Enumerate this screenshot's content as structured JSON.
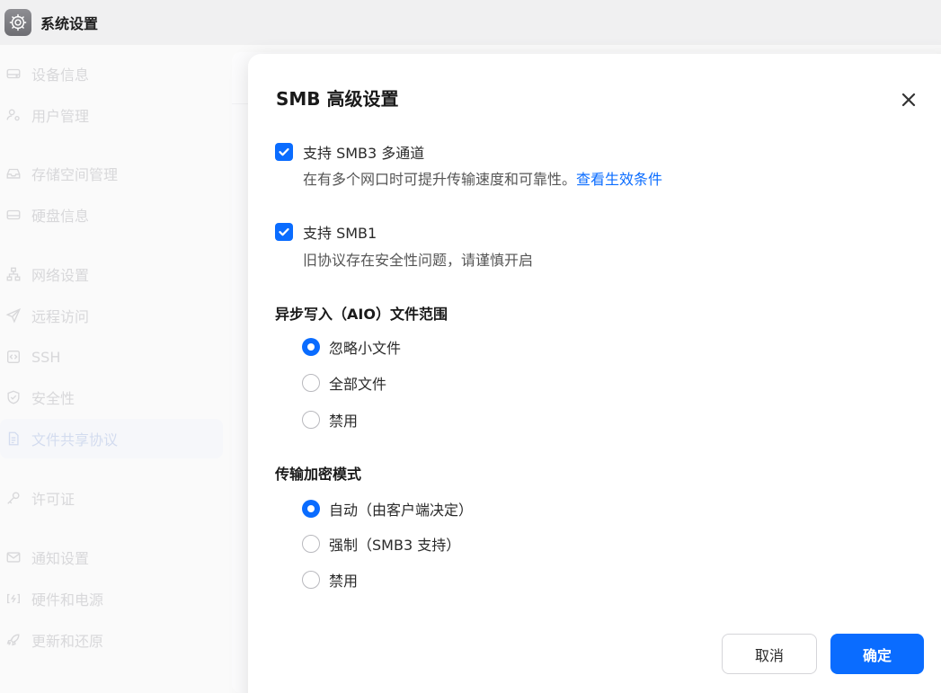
{
  "titlebar": {
    "app_icon": "gear-icon",
    "title": "系统设置"
  },
  "sidebar": {
    "items": [
      {
        "label": "设备信息",
        "icon": "drive-icon"
      },
      {
        "label": "用户管理",
        "icon": "user-settings-icon"
      },
      {
        "label": "存储空间管理",
        "icon": "inbox-icon"
      },
      {
        "label": "硬盘信息",
        "icon": "drive-icon"
      },
      {
        "label": "网络设置",
        "icon": "network-icon"
      },
      {
        "label": "远程访问",
        "icon": "send-icon"
      },
      {
        "label": "SSH",
        "icon": "code-icon"
      },
      {
        "label": "安全性",
        "icon": "shield-icon"
      },
      {
        "label": "文件共享协议",
        "icon": "document-icon",
        "active": true
      },
      {
        "label": "许可证",
        "icon": "key-icon"
      },
      {
        "label": "通知设置",
        "icon": "mail-icon"
      },
      {
        "label": "硬件和电源",
        "icon": "power-icon"
      },
      {
        "label": "更新和还原",
        "icon": "rocket-icon"
      }
    ]
  },
  "modal": {
    "title": "SMB 高级设置",
    "close_icon": "close-icon",
    "options": {
      "multichannel": {
        "label": "支持 SMB3 多通道",
        "checked": true,
        "desc": "在有多个网口时可提升传输速度和可靠性。",
        "link": "查看生效条件"
      },
      "smb1": {
        "label": "支持 SMB1",
        "checked": true,
        "desc": "旧协议存在安全性问题，请谨慎开启"
      }
    },
    "aio": {
      "title": "异步写入（AIO）文件范围",
      "choices": [
        "忽略小文件",
        "全部文件",
        "禁用"
      ],
      "selected": "忽略小文件"
    },
    "encryption": {
      "title": "传输加密模式",
      "choices": [
        "自动（由客户端决定）",
        "强制（SMB3 支持）",
        "禁用"
      ],
      "selected": "自动（由客户端决定）"
    },
    "buttons": {
      "cancel": "取消",
      "ok": "确定"
    },
    "accent": "#0a6cff"
  }
}
